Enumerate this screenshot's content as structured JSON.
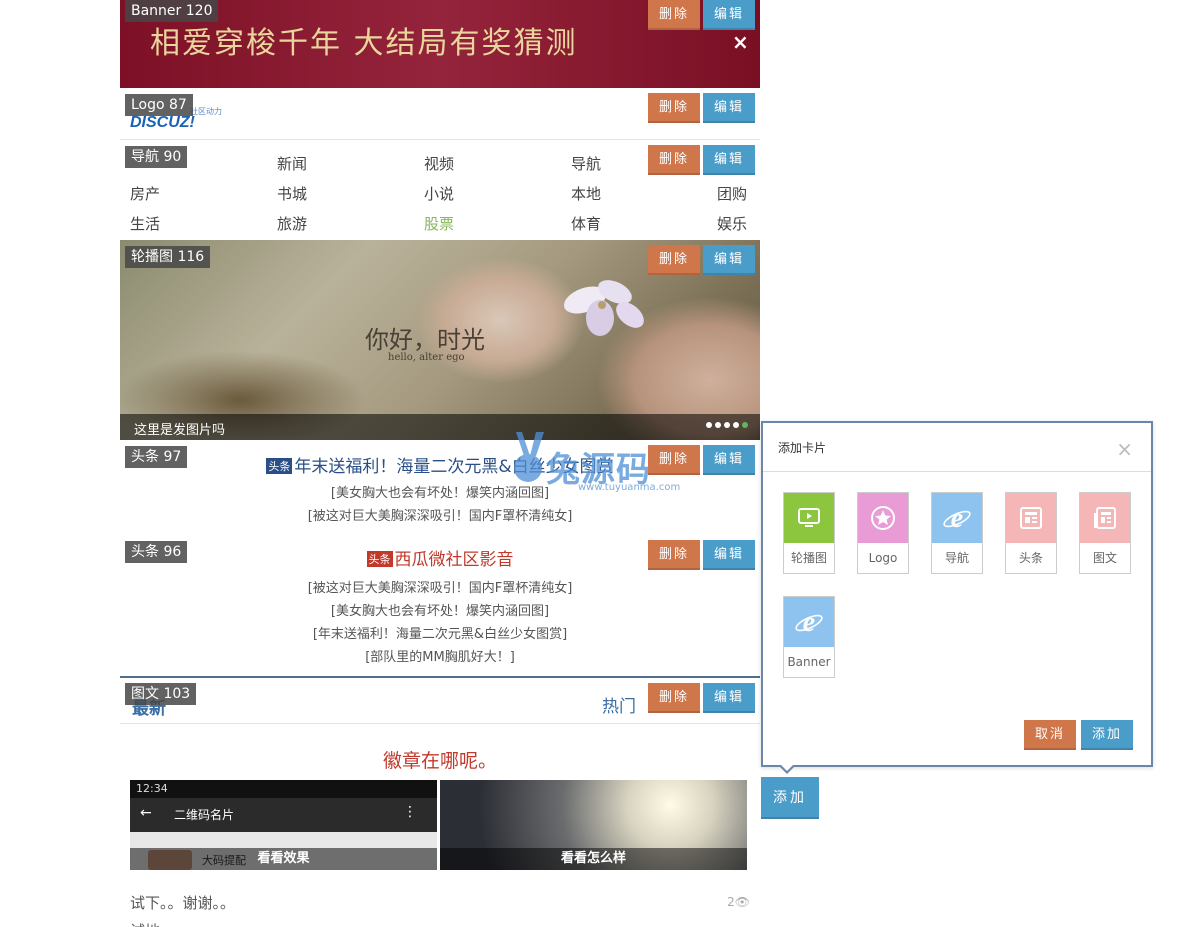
{
  "buttons": {
    "delete": "删除",
    "edit": "编辑"
  },
  "banner": {
    "tag": "Banner 120",
    "text": "相爱穿梭千年 大结局有奖猜测",
    "close": "×"
  },
  "logo": {
    "tag": "Logo 87",
    "mark": "DISCUZ!",
    "sub": "社区动力"
  },
  "nav": {
    "tag": "导航 90",
    "items": [
      "新闻",
      "视频",
      "导航",
      "房产",
      "书城",
      "小说",
      "本地",
      "团购",
      "生活",
      "旅游",
      "股票",
      "体育",
      "娱乐"
    ],
    "highlight": "股票",
    "highlight_color": "#8ab65a"
  },
  "slider": {
    "tag": "轮播图 116",
    "overlay_title": "你好，时光",
    "overlay_sub": "hello, alter ego",
    "caption": "这里是发图片吗",
    "dots": 5,
    "active_dot": 5
  },
  "headline1": {
    "tag": "头条 97",
    "badge": "头条",
    "badge_color": "#2a4f86",
    "title": "年末送福利！海量二次元黑&白丝少女图赏",
    "title_color": "#2a4f86",
    "items": [
      "[美女胸大也会有坏处！爆笑内涵回图]",
      "[被这对巨大美胸深深吸引！国内F罩杯清纯女]"
    ]
  },
  "headline2": {
    "tag": "头条 96",
    "badge": "头条",
    "badge_color": "#c0392b",
    "title": "西瓜微社区影音",
    "title_color": "#c0392b",
    "items": [
      "[被这对巨大美胸深深吸引！国内F罩杯清纯女]",
      "[美女胸大也会有坏处！爆笑内涵回图]",
      "[年末送福利！海量二次元黑&白丝少女图赏]",
      "[部队里的MM胸肌好大！]"
    ]
  },
  "tuwen": {
    "tag": "图文 103",
    "tab_left": "最新",
    "tab_right": "热门",
    "title": "徽章在哪呢。",
    "thumb1_caption": "看看效果",
    "thumb1_status": "12:34",
    "thumb1_header": "二维码名片",
    "thumb1_snippet": "大码提配",
    "thumb2_caption": "看看怎么样",
    "post": "试下。。谢谢。。",
    "views": "2",
    "post2": "试地"
  },
  "watermark": {
    "text": "兔源码",
    "url": "www.tuyuanma.com"
  },
  "modal": {
    "title": "添加卡片",
    "close": "×",
    "tiles": [
      {
        "label": "轮播图",
        "color": "#8cc63f",
        "icon": "play-screen-icon"
      },
      {
        "label": "Logo",
        "color": "#e89bd4",
        "icon": "star-icon"
      },
      {
        "label": "导航",
        "color": "#8fc3ef",
        "icon": "ie-icon"
      },
      {
        "label": "头条",
        "color": "#f4b6b6",
        "icon": "news-icon"
      },
      {
        "label": "图文",
        "color": "#f4b6b6",
        "icon": "newspaper-icon"
      },
      {
        "label": "Banner",
        "color": "#8fc3ef",
        "icon": "ie-icon"
      }
    ],
    "cancel": "取消",
    "add": "添加"
  },
  "add_button": "添加"
}
